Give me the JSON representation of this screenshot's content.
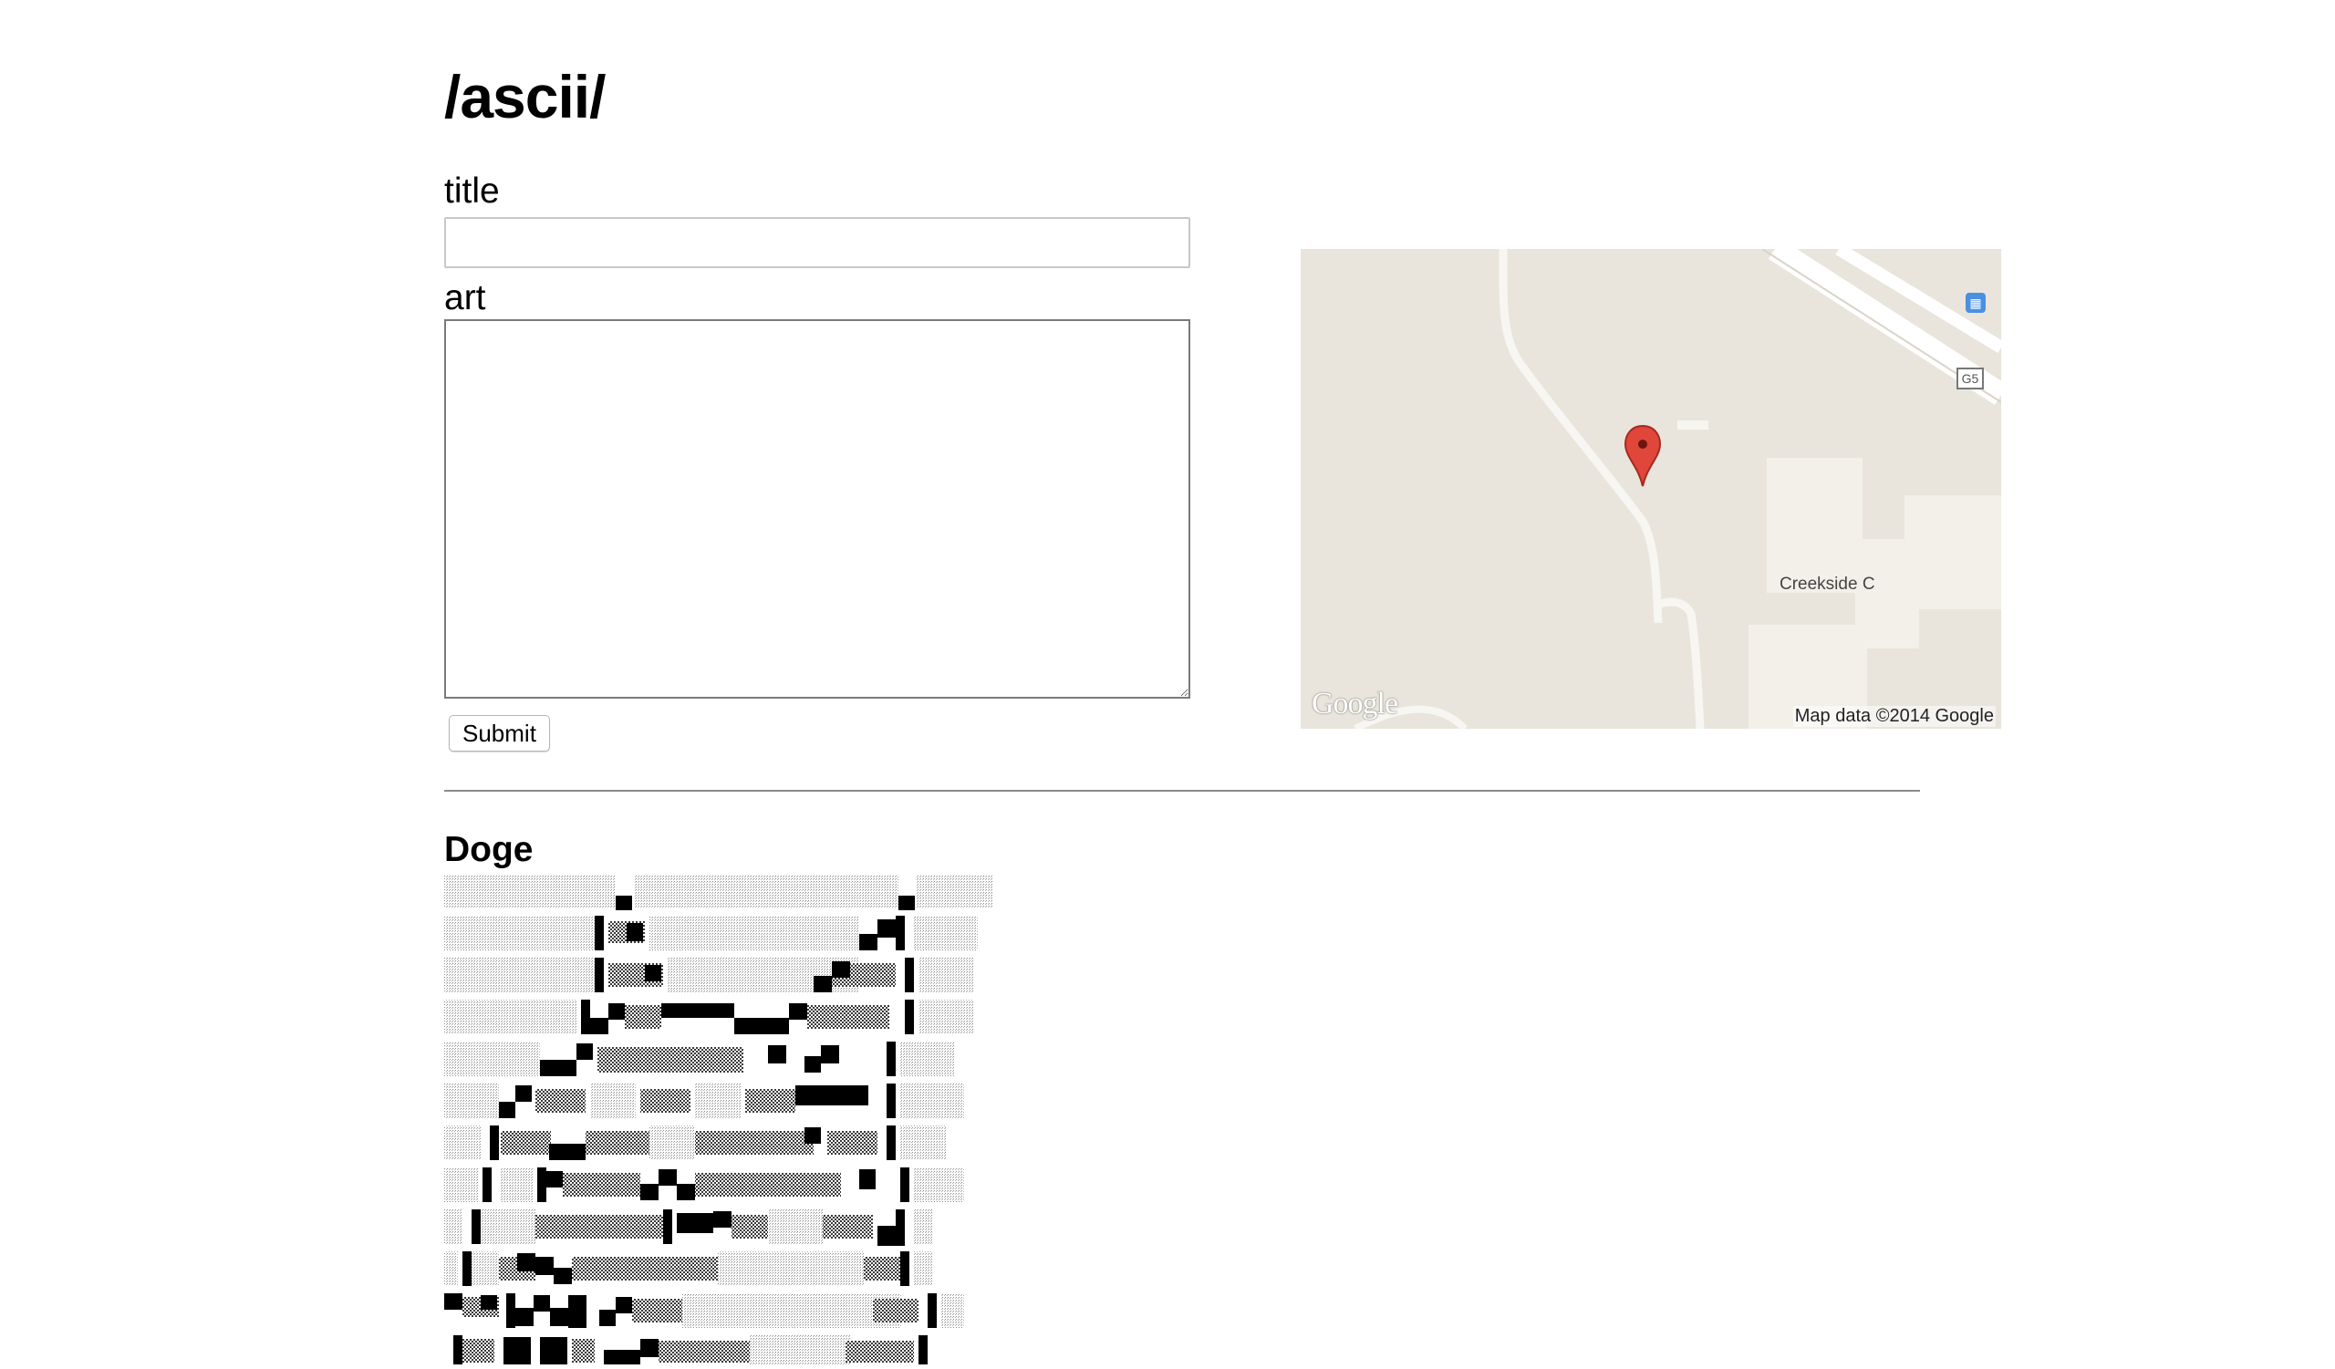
{
  "page": {
    "title": "/ascii/"
  },
  "form": {
    "title_label": "title",
    "title_value": "",
    "art_label": "art",
    "art_value": "",
    "submit_label": "Submit"
  },
  "map": {
    "place_label": "Creekside C",
    "attribution": "Map data ©2014 Google",
    "logo_text": "Google",
    "road_shield": "G5",
    "icons": [
      "map-marker-icon",
      "bus-stop-icon",
      "road-shield-icon"
    ],
    "colors": {
      "land": "#e9e5dc",
      "road": "#ffffff",
      "building": "#f3f0e9",
      "marker": "#e0463a"
    }
  },
  "arts": [
    {
      "title": "Doge"
    }
  ]
}
